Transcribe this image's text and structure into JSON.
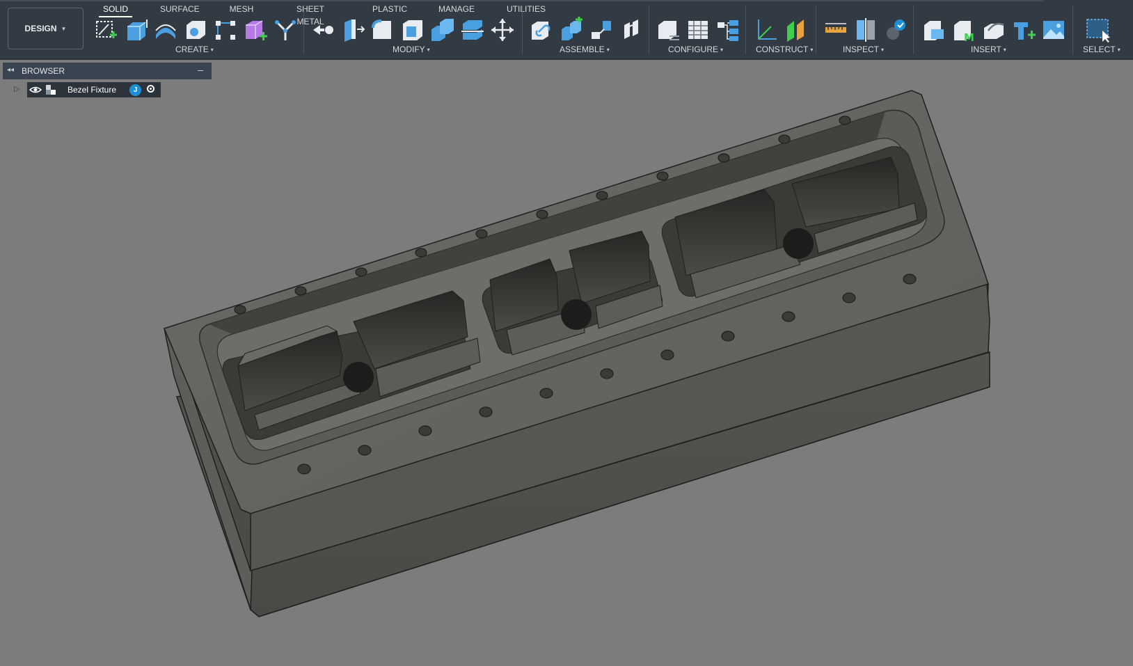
{
  "workspace": {
    "label": "DESIGN"
  },
  "tabs": [
    {
      "label": "SOLID",
      "active": true
    },
    {
      "label": "SURFACE",
      "active": false
    },
    {
      "label": "MESH",
      "active": false
    },
    {
      "label": "SHEET METAL",
      "active": false
    },
    {
      "label": "PLASTIC",
      "active": false
    },
    {
      "label": "MANAGE",
      "active": false
    },
    {
      "label": "UTILITIES",
      "active": false
    }
  ],
  "groups": {
    "create": "CREATE",
    "modify": "MODIFY",
    "assemble": "ASSEMBLE",
    "configure": "CONFIGURE",
    "construct": "CONSTRUCT",
    "inspect": "INSPECT",
    "insert": "INSERT",
    "select": "SELECT"
  },
  "icons": {
    "create": [
      "create-sketch-icon",
      "extrude-icon",
      "revolve-icon",
      "hole-icon",
      "rectangular-pattern-icon",
      "new-component-icon",
      "form-icon"
    ],
    "modify": [
      "press-pull-icon",
      "fillet-pushpull-icon",
      "fillet-icon",
      "shell-icon",
      "combine-icon",
      "split-face-icon",
      "move-copy-icon"
    ],
    "assemble": [
      "new-component-icon",
      "joint-icon",
      "as-built-joint-icon",
      "motion-link-icon"
    ],
    "configure": [
      "configure-icon",
      "configuration-table-icon",
      "configuration-tree-icon"
    ],
    "construct": [
      "axis-icon",
      "offset-plane-icon"
    ],
    "inspect": [
      "measure-icon",
      "section-analysis-icon",
      "display-component-colors-icon"
    ],
    "insert": [
      "insert-derive-icon",
      "insert-mesh-icon",
      "insert-svg-icon",
      "decal-icon",
      "canvas-icon"
    ],
    "select": [
      "window-select-icon"
    ]
  },
  "browser": {
    "title": "BROWSER",
    "root": {
      "name": "Bezel Fixture",
      "badge": "J"
    }
  },
  "colors": {
    "toolbar_bg": "#323a44",
    "viewport_bg": "#7c7c7c",
    "badge": "#1d8fd6"
  }
}
